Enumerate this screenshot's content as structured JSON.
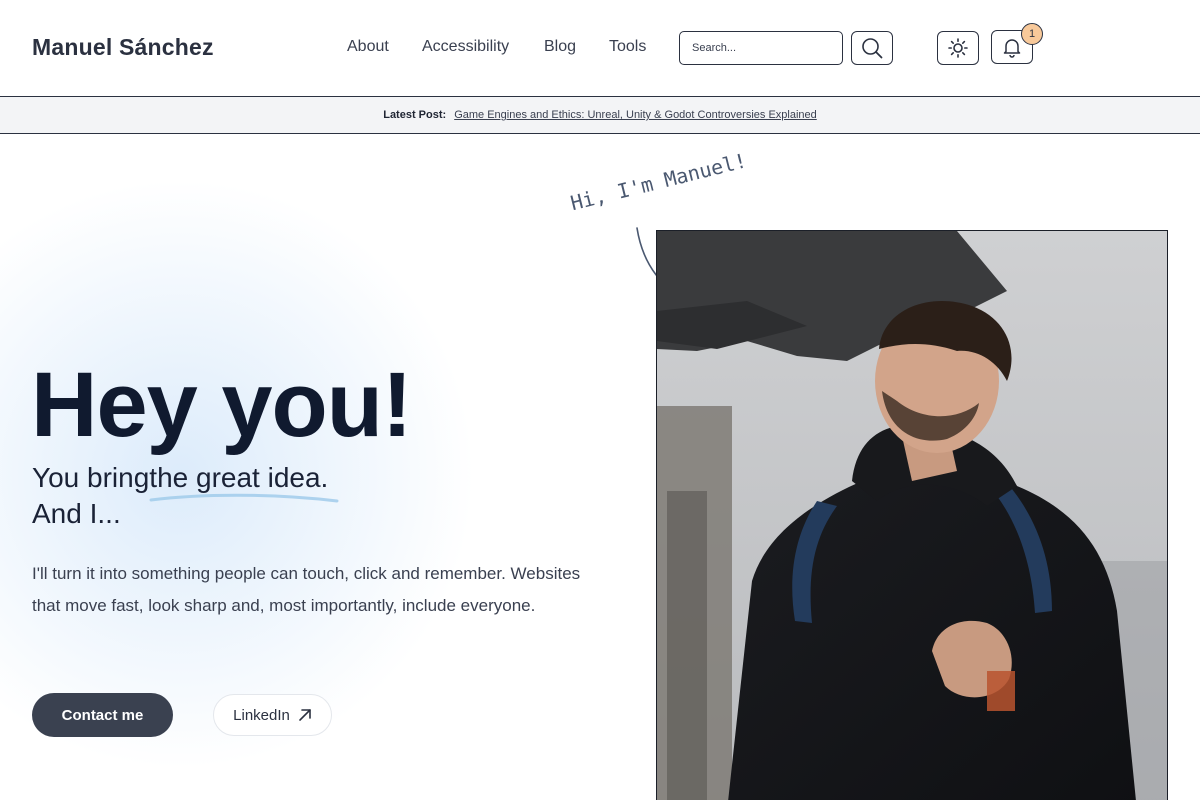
{
  "header": {
    "logo": "Manuel Sánchez",
    "nav": [
      {
        "label": "About"
      },
      {
        "label": "Accessibility"
      },
      {
        "label": "Blog"
      },
      {
        "label": "Tools"
      }
    ],
    "search": {
      "placeholder": "Search...",
      "value": ""
    },
    "notifications": {
      "count": "1"
    },
    "icons": {
      "search_button": "search-icon",
      "theme_toggle": "sun-icon",
      "notifications": "bell-icon"
    }
  },
  "announcement": {
    "label": "Latest Post:",
    "link_text": "Game Engines and Ethics: Unreal, Unity & Godot Controversies Explained"
  },
  "hero": {
    "title": "Hey you!",
    "subtitle_part1": "You bring",
    "subtitle_highlight": "the great idea.",
    "subtitle_line2": "And I...",
    "body": "I'll turn it into something people can touch, click and remember. Websites that move fast, look sharp and, most importantly, include everyone.",
    "contact_label": "Contact me",
    "linkedin_label": "LinkedIn",
    "greeting": "Hi, I'm Manuel!"
  },
  "colors": {
    "primary_text": "#101a2f",
    "button_dark": "#3a4150",
    "badge": "#f8c99a",
    "hero_glow": "#d6e8fa"
  }
}
